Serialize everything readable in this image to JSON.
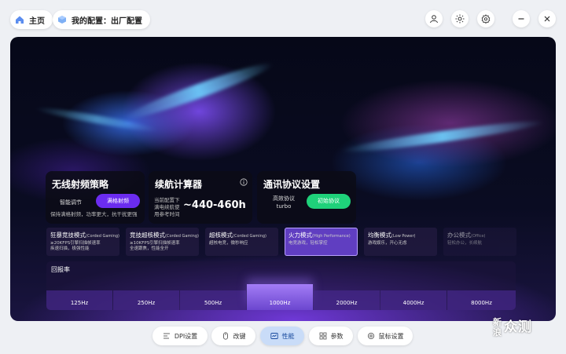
{
  "header": {
    "home_label": "主页",
    "config_label": "我的配置：出厂配置"
  },
  "cards": {
    "rf": {
      "title": "无线射频策略",
      "smart_label": "智能调节",
      "full_button": "满格射频",
      "desc": "保持满格射频，功率更大，抗干扰更强"
    },
    "battery": {
      "title": "续航计算器",
      "desc_line1": "当前配置下",
      "desc_line2": "满电续航使",
      "desc_line3": "用参考时间",
      "value": "~440-460h",
      "info_icon": "info-icon"
    },
    "protocol": {
      "title": "通讯协议设置",
      "efficient_label": "高效协议",
      "turbo_label": "turbo",
      "initial_button": "初始协议"
    }
  },
  "modes": [
    {
      "title": "狂暴竞技模式",
      "en": "(Corded Gaming)",
      "desc1": "≥20KFPS引擎扫描帧速率",
      "desc2": "疾速扫描，极强性能"
    },
    {
      "title": "竞技超核模式",
      "en": "(Corded Gaming)",
      "desc1": "≥10KFPS引擎扫描帧速率",
      "desc2": "全速跟焦，性能全开"
    },
    {
      "title": "超核模式",
      "en": "(Corded Gaming)",
      "desc1": "超核电竞，微秒响应",
      "desc2": ""
    },
    {
      "title": "火力模式",
      "en": "(High Performance)",
      "desc1": "电竞游戏，轻松掌控",
      "desc2": ""
    },
    {
      "title": "均衡模式",
      "en": "(Low Power)",
      "desc1": "游戏娱乐，开心无虑",
      "desc2": ""
    },
    {
      "title": "办公模式",
      "en": "(Office)",
      "desc1": "轻松办公，长续航",
      "desc2": ""
    }
  ],
  "polling": {
    "label": "回报率",
    "rates": [
      "125Hz",
      "250Hz",
      "500Hz",
      "1000Hz",
      "2000Hz",
      "4000Hz",
      "8000Hz"
    ],
    "selected": "1000Hz"
  },
  "nav": [
    {
      "label": "DPI设置",
      "icon": "dpi-icon"
    },
    {
      "label": "改键",
      "icon": "mouse-icon"
    },
    {
      "label": "性能",
      "icon": "performance-icon"
    },
    {
      "label": "参数",
      "icon": "grid-icon"
    },
    {
      "label": "鼠标设置",
      "icon": "settings-icon"
    }
  ],
  "watermark": {
    "line1": "新",
    "line2": "浪",
    "line3": "众测"
  },
  "colors": {
    "accent_purple": "#6b2cf0",
    "accent_green": "#1fd17a",
    "nav_active": "#c9dcf8"
  }
}
